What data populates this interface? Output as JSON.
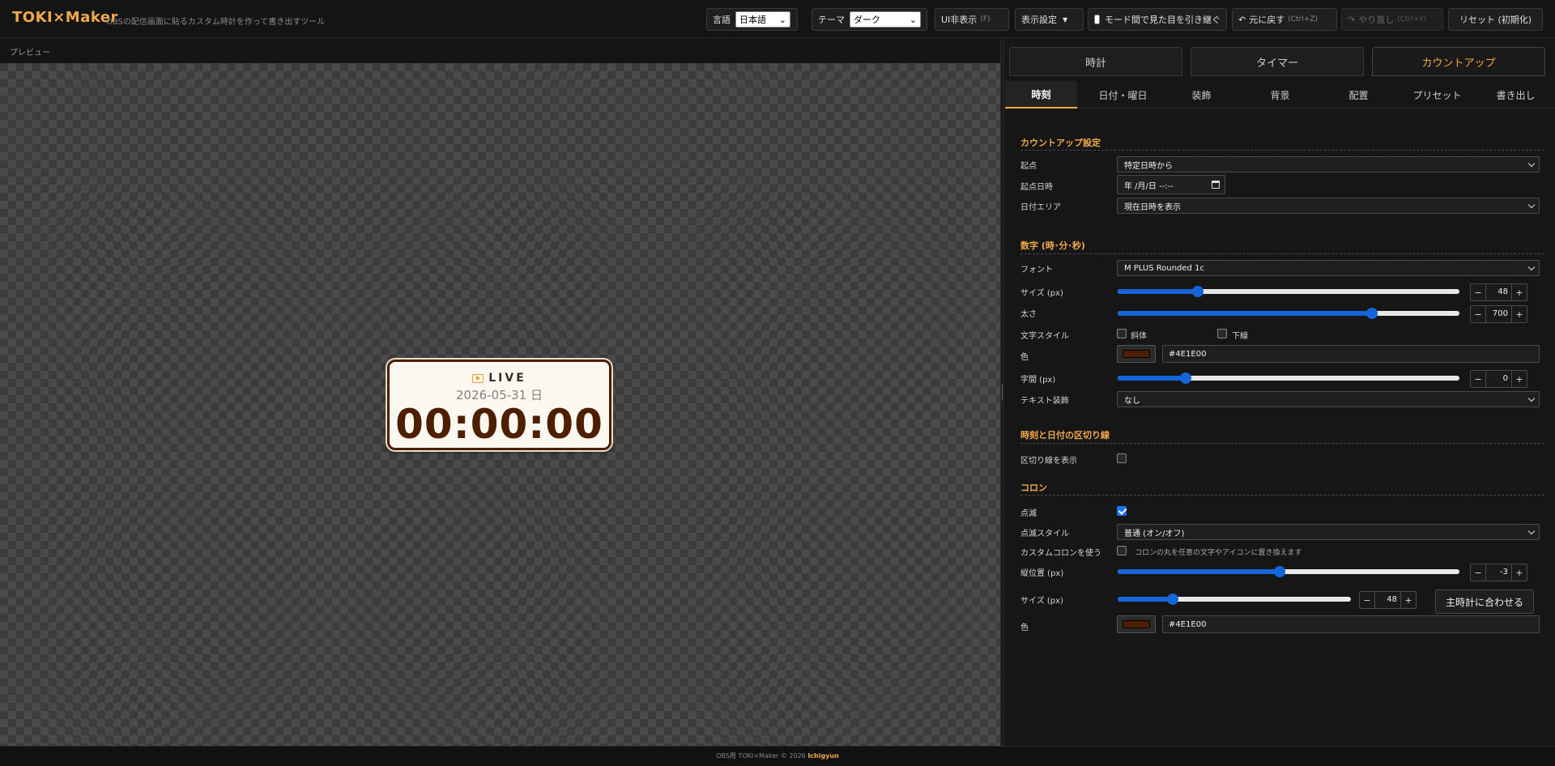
{
  "header": {
    "brand": "TOKI×Maker",
    "tagline": "OBSの配信画面に貼るカスタム時計を作って書き出すツール",
    "language_label": "言語",
    "language_value": "日本語",
    "theme_label": "テーマ",
    "theme_value": "ダーク",
    "hide_ui_label": "UI非表示",
    "hide_ui_hint": "(F)",
    "display_settings_label": "表示設定",
    "carry_over_label": "モード間で見た目を引き継ぐ",
    "undo_label": "元に戻す",
    "undo_hint": "(Ctrl+Z)",
    "redo_label": "やり直し",
    "redo_hint": "(Ctrl+Y)",
    "reset_label": "リセット (初期化)"
  },
  "preview": {
    "label": "プレビュー",
    "live_text": "LIVE",
    "date_text": "2026-05-31 日",
    "time_text": "00:00:00"
  },
  "main_tabs": [
    "時計",
    "タイマー",
    "カウントアップ"
  ],
  "sub_tabs": [
    "時刻",
    "日付・曜日",
    "装飾",
    "背景",
    "配置",
    "プリセット",
    "書き出し"
  ],
  "countup": {
    "title": "カウントアップ設定",
    "origin_label": "起点",
    "origin_value": "特定日時から",
    "origin_datetime_label": "起点日時",
    "origin_datetime_value": "年 /月/日 --:--",
    "date_area_label": "日付エリア",
    "date_area_value": "現在日時を表示"
  },
  "digits": {
    "title": "数字 (時･分･秒)",
    "font_label": "フォント",
    "font_value": "M PLUS Rounded 1c",
    "size_label": "サイズ (px)",
    "size_value": "48",
    "size_fraction": 0.235,
    "weight_label": "太さ",
    "weight_value": "700",
    "weight_fraction": 0.745,
    "style_label": "文字スタイル",
    "italic_label": "斜体",
    "underline_label": "下線",
    "color_label": "色",
    "color_value": "#4E1E00",
    "spacing_label": "字間 (px)",
    "spacing_value": "0",
    "spacing_fraction": 0.2,
    "text_deco_label": "テキスト装飾",
    "text_deco_value": "なし"
  },
  "divider": {
    "title": "時刻と日付の区切り線",
    "show_label": "区切り線を表示"
  },
  "colon": {
    "title": "コロン",
    "blink_label": "点滅",
    "blink_style_label": "点滅スタイル",
    "blink_style_value": "普通 (オン/オフ)",
    "custom_label": "カスタムコロンを使う",
    "custom_hint": "コロンの丸を任意の文字やアイコンに置き換えます",
    "vpos_label": "縦位置 (px)",
    "vpos_value": "-3",
    "vpos_fraction": 0.475,
    "size_label": "サイズ (px)",
    "size_value": "48",
    "size_fraction": 0.235,
    "match_label": "主時計に合わせる",
    "color_label": "色",
    "color_value": "#4E1E00"
  },
  "footer": {
    "text": "OBS用 TOKI×Maker © 2026",
    "author": "Ichigyun"
  },
  "colors": {
    "accent": "#f2a94a",
    "clock_text": "#4E1E00",
    "slider": "#1565d8"
  }
}
